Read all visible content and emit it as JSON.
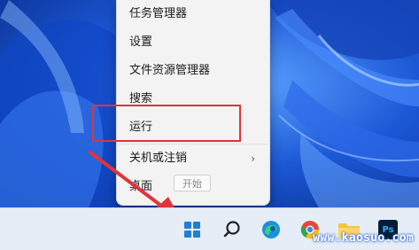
{
  "context_menu": {
    "items": [
      {
        "label": "任务管理器"
      },
      {
        "label": "设置"
      },
      {
        "label": "文件资源管理器"
      },
      {
        "label": "搜索"
      },
      {
        "label": "运行"
      },
      {
        "label": "关机或注销"
      },
      {
        "label": "桌面"
      }
    ],
    "submenu_chevron": "›",
    "tooltip": "开始"
  },
  "taskbar": {
    "icons": [
      "windows-start-icon",
      "search-icon",
      "edge-icon",
      "chrome-icon",
      "file-explorer-icon",
      "photoshop-icon"
    ],
    "ps_label": "Ps"
  },
  "watermark": "www.kaosuo.com",
  "colors": {
    "accent": "#1e7fd8",
    "highlight_box": "#e0343a",
    "arrow": "#e0343a",
    "desktop": "#0b3eb0"
  }
}
